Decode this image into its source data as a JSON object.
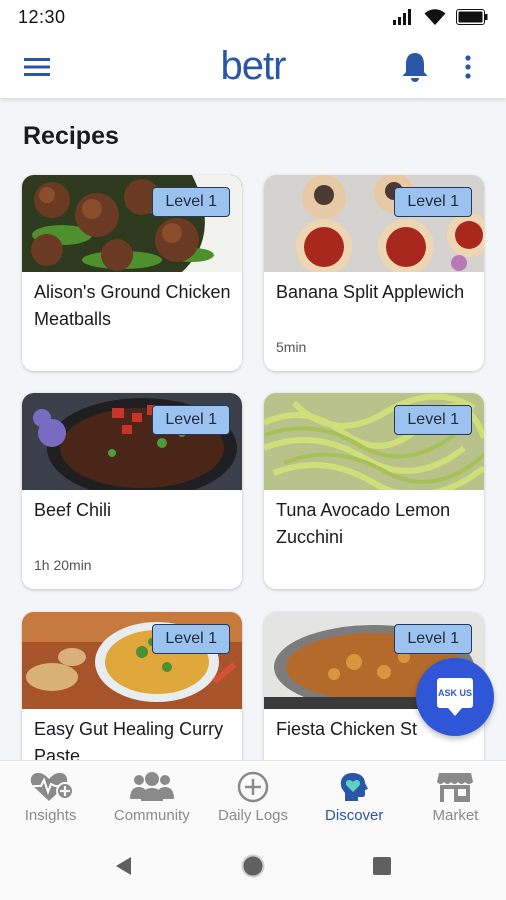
{
  "status_bar": {
    "time": "12:30"
  },
  "app_bar": {
    "logo": "betr"
  },
  "page": {
    "title": "Recipes"
  },
  "recipes": [
    {
      "title": "Alison's Ground Chicken Meatballs",
      "level": "Level 1",
      "time": ""
    },
    {
      "title": "Banana Split Applewich",
      "level": "Level 1",
      "time": "5min"
    },
    {
      "title": "Beef Chili",
      "level": "Level 1",
      "time": "1h 20min"
    },
    {
      "title": "Tuna Avocado Lemon Zucchini",
      "level": "Level 1",
      "time": ""
    },
    {
      "title": "Easy Gut Healing Curry Paste",
      "level": "Level 1",
      "time": ""
    },
    {
      "title": "Fiesta Chicken St",
      "level": "Level 1",
      "time": ""
    }
  ],
  "fab": {
    "label": "ASK US"
  },
  "bottom_nav": [
    {
      "label": "Insights",
      "icon": "heart-pulse-icon",
      "active": false
    },
    {
      "label": "Community",
      "icon": "people-icon",
      "active": false
    },
    {
      "label": "Daily Logs",
      "icon": "plus-circle-icon",
      "active": false
    },
    {
      "label": "Discover",
      "icon": "head-heart-icon",
      "active": true
    },
    {
      "label": "Market",
      "icon": "store-icon",
      "active": false
    }
  ],
  "colors": {
    "brand": "#2a56a8",
    "badge_bg": "#9cc3f0",
    "fab": "#2f56d6",
    "inactive": "#8a8a8a"
  }
}
